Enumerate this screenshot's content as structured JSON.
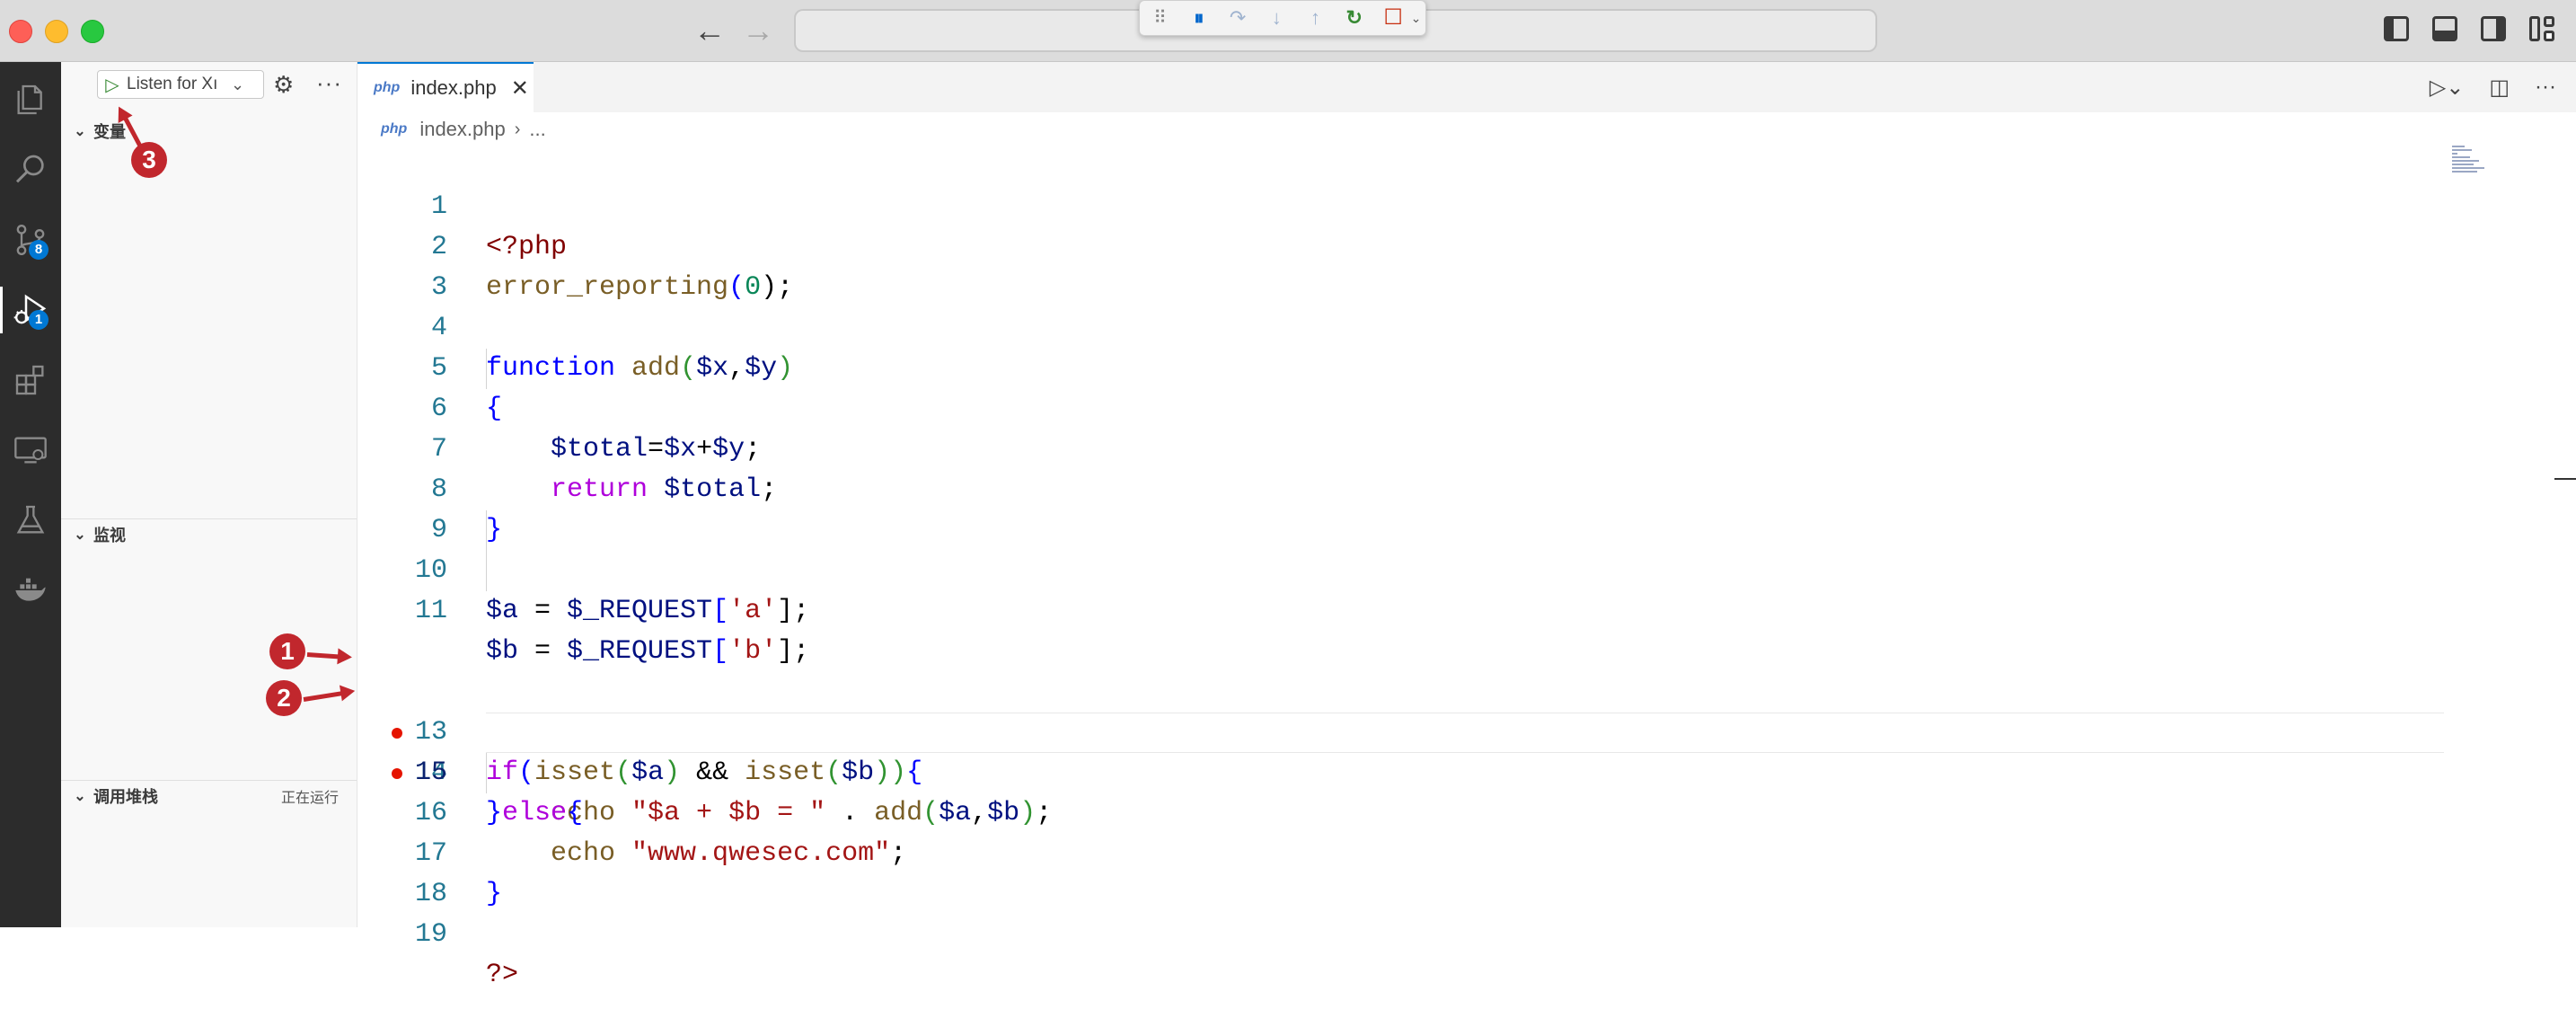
{
  "titlebar": {
    "nav_back_icon": "arrow-left-icon",
    "nav_forward_icon": "arrow-right-icon",
    "command_center_text": ""
  },
  "debug_toolbar": {
    "buttons": [
      "drag-handle",
      "pause",
      "step-over",
      "step-into",
      "step-out",
      "restart",
      "stop"
    ],
    "colors": {
      "pause": "#0066cc",
      "restart": "#388a34",
      "stop": "#c72e0f"
    }
  },
  "activity_bar": {
    "source_control_badge": "8",
    "run_debug_badge": "1"
  },
  "sidebar": {
    "run_config_label": "Listen for Xdebug",
    "run_config_label_visible": "Listen for Xı",
    "sections": {
      "variables": "变量",
      "watch": "监视",
      "call_stack": "调用堆栈",
      "call_stack_status": "正在运行"
    }
  },
  "editor": {
    "tab": {
      "lang_badge": "php",
      "filename": "index.php",
      "close": "✕"
    },
    "breadcrumbs": {
      "lang_badge": "php",
      "file": "index.php",
      "separator": "›",
      "more": "..."
    },
    "current_line": "15",
    "breakpoint_lines": [
      "13",
      "14"
    ],
    "lines": [
      {
        "n": "1"
      },
      {
        "n": "2"
      },
      {
        "n": "3"
      },
      {
        "n": "4"
      },
      {
        "n": "5"
      },
      {
        "n": "6"
      },
      {
        "n": "7"
      },
      {
        "n": "8"
      },
      {
        "n": "9"
      },
      {
        "n": "10"
      },
      {
        "n": "11"
      },
      {
        "n": "13"
      },
      {
        "n": "14"
      },
      {
        "n": "15"
      },
      {
        "n": "16"
      },
      {
        "n": "17"
      },
      {
        "n": "18"
      },
      {
        "n": "19"
      }
    ],
    "code": {
      "l1": [
        "<?php"
      ],
      "l2": [
        "error_reporting",
        "(",
        "0",
        ");"
      ],
      "l4": [
        "function",
        " ",
        "add",
        "(",
        "$x",
        ",",
        "$y",
        ")"
      ],
      "l5": [
        "{"
      ],
      "l6": [
        "    ",
        "$total",
        "=",
        "$x",
        "+",
        "$y",
        ";"
      ],
      "l7": [
        "    ",
        "return",
        " ",
        "$total",
        ";"
      ],
      "l8": [
        "}"
      ],
      "l10": [
        "$a",
        " = ",
        "$_REQUEST",
        "[",
        "'a'",
        "];"
      ],
      "l11": [
        "$b",
        " = ",
        "$_REQUEST",
        "[",
        "'b'",
        "];"
      ],
      "l13": [
        "if",
        "(",
        "isset",
        "(",
        "$a",
        ")",
        " && ",
        "isset",
        "(",
        "$b",
        "))",
        "{"
      ],
      "l14": [
        "    ",
        "echo",
        " ",
        "\"$a + $b = \"",
        " . ",
        "add",
        "(",
        "$a",
        ",",
        "$b",
        ")",
        ";"
      ],
      "l15": [
        "}",
        "else",
        "{"
      ],
      "l16": [
        "    ",
        "echo",
        " ",
        "\"www.qwesec.com\"",
        ";"
      ],
      "l17": [
        "}"
      ],
      "l19": [
        "?>"
      ]
    }
  },
  "annotations": [
    "1",
    "2",
    "3"
  ]
}
